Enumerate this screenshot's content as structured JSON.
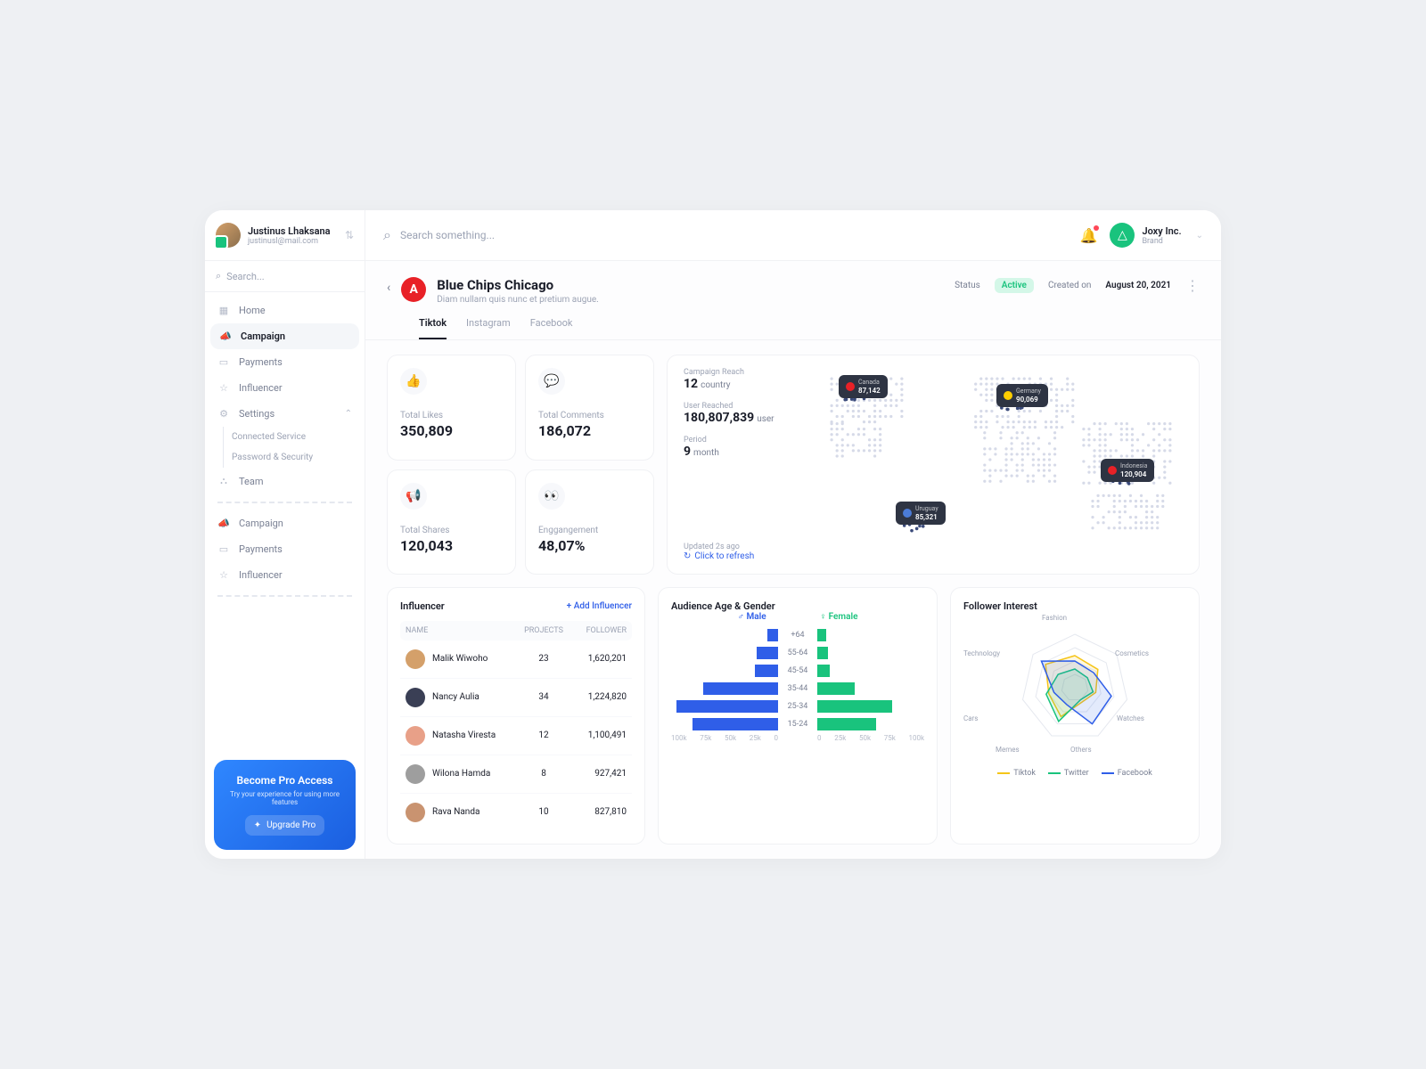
{
  "profile": {
    "name": "Justinus Lhaksana",
    "email": "justinusl@mail.com"
  },
  "sidebar": {
    "search_placeholder": "Search...",
    "items": [
      "Home",
      "Campaign",
      "Payments",
      "Influencer",
      "Settings"
    ],
    "subitems": [
      "Connected Service",
      "Password & Security"
    ],
    "team": "Team",
    "secondary": [
      "Campaign",
      "Payments",
      "Influencer"
    ]
  },
  "pro": {
    "title": "Become Pro Access",
    "subtitle": "Try your experience for using more features",
    "button": "Upgrade Pro"
  },
  "topbar": {
    "search_placeholder": "Search something...",
    "brand_name": "Joxy Inc.",
    "brand_role": "Brand"
  },
  "campaign": {
    "title": "Blue Chips Chicago",
    "desc": "Diam nullam quis nunc et pretium augue.",
    "status_label": "Status",
    "status_value": "Active",
    "created_label": "Created on",
    "created_value": "August 20, 2021",
    "tabs": [
      "Tiktok",
      "Instagram",
      "Facebook"
    ]
  },
  "stats": [
    {
      "icon": "👍",
      "label": "Total  Likes",
      "value": "350,809"
    },
    {
      "icon": "💬",
      "label": "Total Comments",
      "value": "186,072"
    },
    {
      "icon": "📢",
      "label": "Total Shares",
      "value": "120,043"
    },
    {
      "icon": "👀",
      "label": "Enggangement",
      "value": "48,07%"
    }
  ],
  "map": {
    "reach_label": "Campaign Reach",
    "reach_value": "12",
    "reach_unit": "country",
    "user_label": "User Reached",
    "user_value": "180,807,839",
    "user_unit": "user",
    "period_label": "Period",
    "period_value": "9",
    "period_unit": "month",
    "updated": "Updated 2s ago",
    "refresh": "Click to refresh",
    "pins": [
      {
        "country": "Canada",
        "value": "87,142",
        "flag": "#e82127"
      },
      {
        "country": "Germany",
        "value": "90,069",
        "flag": "#ffce00"
      },
      {
        "country": "Indonesia",
        "value": "120,904",
        "flag": "#e82127"
      },
      {
        "country": "Uruguay",
        "value": "85,321",
        "flag": "#4b7bd6"
      }
    ]
  },
  "influencer": {
    "title": "Influencer",
    "add": "+ Add Influencer",
    "cols": [
      "NAME",
      "PROJECTS",
      "FOLLOWER"
    ],
    "rows": [
      {
        "name": "Malik Wiwoho",
        "projects": "23",
        "followers": "1,620,201",
        "color": "#d4a06a"
      },
      {
        "name": "Nancy Aulia",
        "projects": "34",
        "followers": "1,224,820",
        "color": "#3a3f55"
      },
      {
        "name": "Natasha Viresta",
        "projects": "12",
        "followers": "1,100,491",
        "color": "#e8a088"
      },
      {
        "name": "Wilona Hamda",
        "projects": "8",
        "followers": "927,421",
        "color": "#9e9e9e"
      },
      {
        "name": "Rava Nanda",
        "projects": "10",
        "followers": "827,810",
        "color": "#c99370"
      }
    ]
  },
  "age": {
    "title": "Audience Age & Gender",
    "male": "Male",
    "female": "Female",
    "rows": [
      "+64",
      "55-64",
      "45-54",
      "35-44",
      "25-34",
      "15-24"
    ],
    "maleAxis": [
      "100k",
      "75k",
      "50k",
      "25k",
      "0"
    ],
    "femaleAxis": [
      "0",
      "25k",
      "50k",
      "75k",
      "100k"
    ]
  },
  "interest": {
    "title": "Follower Interest",
    "labels": [
      "Fashion",
      "Cosmetics",
      "Watches",
      "Others",
      "Memes",
      "Cars",
      "Technology"
    ],
    "legend": [
      "Tiktok",
      "Twitter",
      "Facebook"
    ]
  },
  "chart_data": {
    "age_gender": {
      "type": "bar",
      "title": "Audience Age & Gender",
      "categories": [
        "+64",
        "55-64",
        "45-54",
        "35-44",
        "25-34",
        "15-24"
      ],
      "series": [
        {
          "name": "Male",
          "values": [
            10000,
            20000,
            22000,
            70000,
            95000,
            80000
          ]
        },
        {
          "name": "Female",
          "values": [
            8000,
            10000,
            12000,
            35000,
            70000,
            55000
          ]
        }
      ],
      "xlabel": "",
      "ylabel": "",
      "xlim": [
        0,
        100000
      ]
    },
    "follower_interest": {
      "type": "radar",
      "title": "Follower Interest",
      "categories": [
        "Fashion",
        "Cosmetics",
        "Watches",
        "Others",
        "Memes",
        "Cars",
        "Technology"
      ],
      "series": [
        {
          "name": "Tiktok",
          "values": [
            60,
            55,
            40,
            30,
            60,
            50,
            70
          ]
        },
        {
          "name": "Twitter",
          "values": [
            35,
            30,
            35,
            25,
            70,
            55,
            40
          ]
        },
        {
          "name": "Facebook",
          "values": [
            50,
            45,
            70,
            75,
            35,
            40,
            80
          ]
        }
      ],
      "range": [
        0,
        100
      ]
    }
  }
}
